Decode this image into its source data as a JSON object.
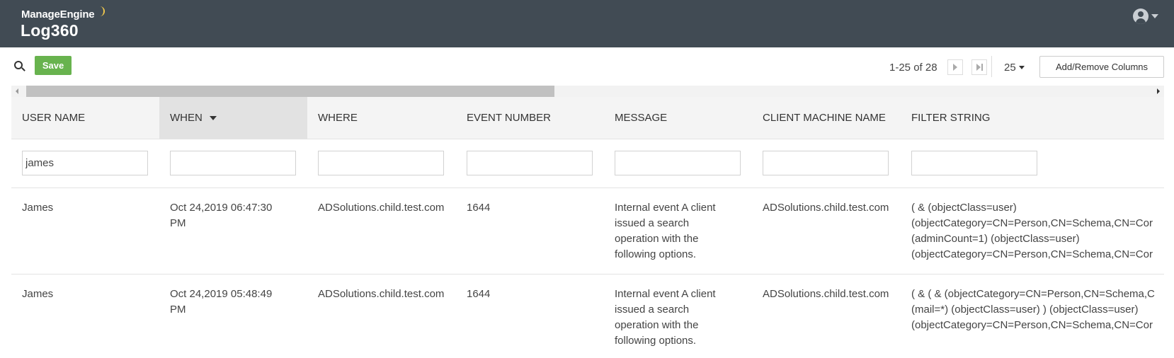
{
  "header": {
    "vendor": "ManageEngine",
    "product": "Log360"
  },
  "toolbar": {
    "save_label": "Save",
    "pager_text": "1-25 of 28",
    "page_size": "25",
    "add_remove_columns_label": "Add/Remove Columns"
  },
  "table": {
    "columns": [
      {
        "label": "USER NAME"
      },
      {
        "label": "WHEN"
      },
      {
        "label": "WHERE"
      },
      {
        "label": "EVENT NUMBER"
      },
      {
        "label": "MESSAGE"
      },
      {
        "label": "CLIENT MACHINE NAME"
      },
      {
        "label": "FILTER STRING"
      }
    ],
    "sorted_column": "WHEN",
    "filters": [
      "james",
      "",
      "",
      "",
      "",
      "",
      ""
    ],
    "rows": [
      {
        "user_name": "James",
        "when": "Oct 24,2019 06:47:30 PM",
        "where": "ADSolutions.child.test.com",
        "event_number": "1644",
        "message": "Internal event A client issued a search operation with the following options.",
        "client_machine_name": "ADSolutions.child.test.com",
        "filter_lines": [
          "( & (objectClass=user)",
          "(objectCategory=CN=Person,CN=Schema,CN=Cor",
          "(adminCount=1) (objectClass=user)",
          "(objectCategory=CN=Person,CN=Schema,CN=Cor"
        ]
      },
      {
        "user_name": "James",
        "when": "Oct 24,2019 05:48:49 PM",
        "where": "ADSolutions.child.test.com",
        "event_number": "1644",
        "message": "Internal event A client issued a search operation with the following options.",
        "client_machine_name": "ADSolutions.child.test.com",
        "filter_lines": [
          "( & ( & (objectCategory=CN=Person,CN=Schema,C",
          "(mail=*) (objectClass=user) ) (objectClass=user)",
          "(objectCategory=CN=Person,CN=Schema,CN=Cor"
        ]
      }
    ]
  },
  "icons": {
    "user_menu": "user-avatar-icon",
    "search_toggle": "search-icon",
    "next_page": "next-page-icon",
    "last_page": "last-page-icon"
  },
  "colors": {
    "header_bg": "#414b54",
    "save_green": "#68b34e",
    "sorted_column_bg": "#e2e2e2"
  }
}
